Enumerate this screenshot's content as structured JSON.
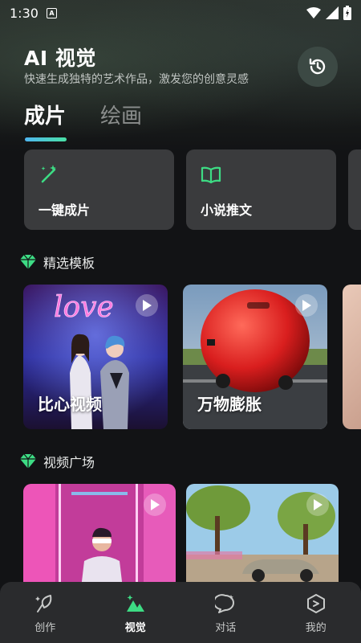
{
  "status_bar": {
    "time": "1:30",
    "notif_letter": "A"
  },
  "header": {
    "title": "AI 视觉",
    "subtitle": "快速生成独特的艺术作品，激发您的创意灵感"
  },
  "tabs": [
    {
      "label": "成片",
      "active": true
    },
    {
      "label": "绘画",
      "active": false
    }
  ],
  "quick_actions": [
    {
      "label": "一键成片",
      "icon": "magic-wand-icon"
    },
    {
      "label": "小说推文",
      "icon": "open-book-icon"
    }
  ],
  "featured_section": {
    "title": "精选模板"
  },
  "templates": [
    {
      "label": "比心视频",
      "neon_text": "love"
    },
    {
      "label": "万物膨胀"
    }
  ],
  "video_section": {
    "title": "视频广场"
  },
  "bottom_nav": [
    {
      "label": "创作",
      "icon": "quill-icon",
      "active": false
    },
    {
      "label": "视觉",
      "icon": "triangles-icon",
      "active": true
    },
    {
      "label": "对话",
      "icon": "chat-bubble-icon",
      "active": false
    },
    {
      "label": "我的",
      "icon": "hexagon-icon",
      "active": false
    }
  ],
  "colors": {
    "accent": "#3ddc84",
    "background": "#121315",
    "card": "#3a3b3d",
    "nav": "#2a2b2d"
  }
}
